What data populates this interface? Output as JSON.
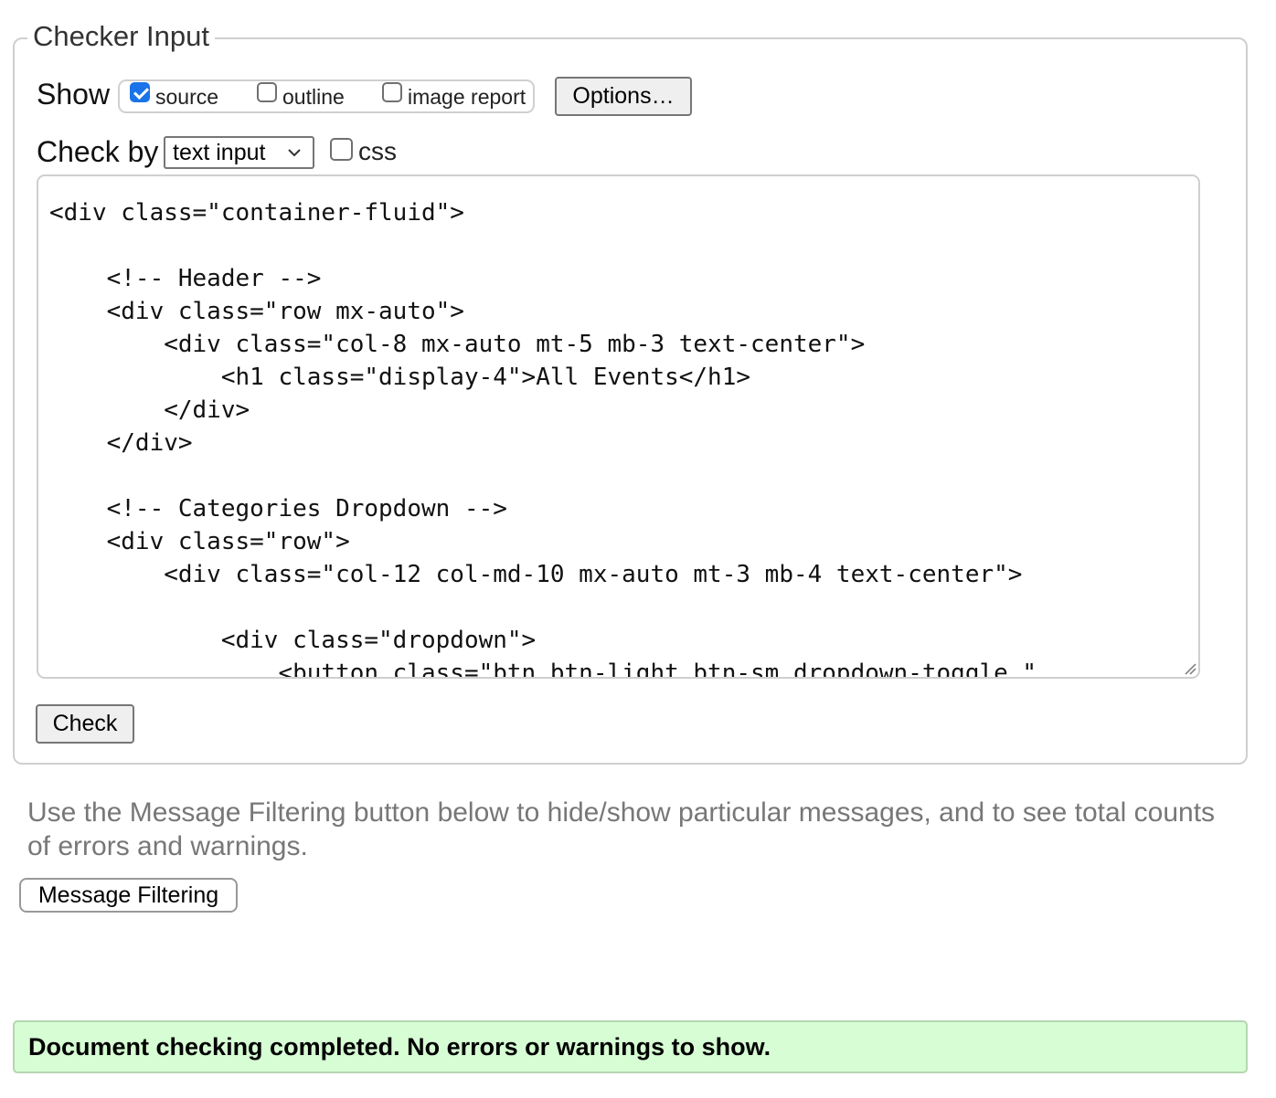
{
  "checker": {
    "legend": "Checker Input",
    "show_label": "Show",
    "show_options": [
      {
        "label": "source",
        "checked": true
      },
      {
        "label": "outline",
        "checked": false
      },
      {
        "label": "image report",
        "checked": false
      }
    ],
    "options_button": "Options…",
    "check_by_label": "Check by",
    "check_by_value": "text input",
    "css_label": "css",
    "css_checked": false,
    "source_text": "<div class=\"container-fluid\">\n\n    <!-- Header -->\n    <div class=\"row mx-auto\">\n        <div class=\"col-8 mx-auto mt-5 mb-3 text-center\">\n            <h1 class=\"display-4\">All Events</h1>\n        </div>\n    </div>\n\n    <!-- Categories Dropdown -->\n    <div class=\"row\">\n        <div class=\"col-12 col-md-10 mx-auto mt-3 mb-4 text-center\">\n\n            <div class=\"dropdown\">\n                <button class=\"btn btn-light btn-sm dropdown-toggle \"",
    "check_button": "Check"
  },
  "filter_note": "Use the Message Filtering button below to hide/show particular messages, and to see total counts of errors and warnings.",
  "message_filtering_button": "Message Filtering",
  "status_message": "Document checking completed. No errors or warnings to show.",
  "colors": {
    "status_background": "#d6fdd3",
    "checkbox_accent": "#1a73e8",
    "note_text": "#777777"
  }
}
